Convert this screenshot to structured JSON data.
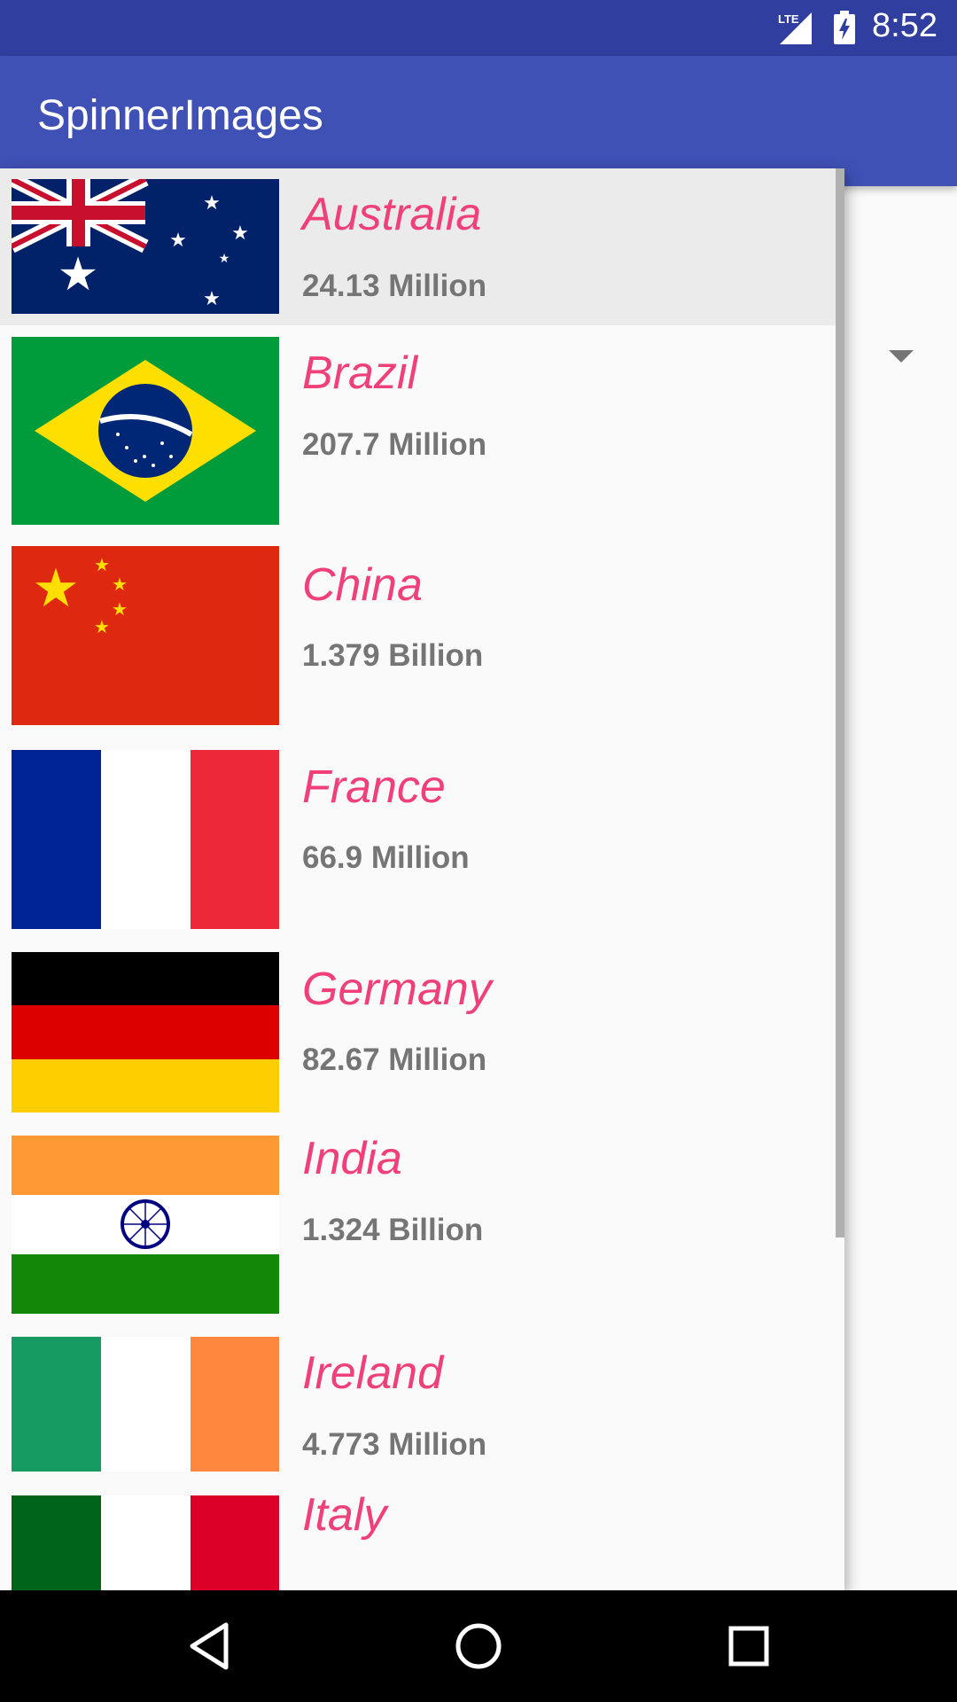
{
  "status_bar": {
    "time": "8:52",
    "network_label": "LTE",
    "icons": [
      "lte-signal-icon",
      "battery-charging-icon"
    ]
  },
  "app_bar": {
    "title": "SpinnerImages"
  },
  "spinner": {
    "arrow_icon": "dropdown-arrow-icon"
  },
  "countries": [
    {
      "name": "Australia",
      "population": "24.13 Million",
      "flag_icon": "australia-flag-icon",
      "selected": true
    },
    {
      "name": "Brazil",
      "population": "207.7 Million",
      "flag_icon": "brazil-flag-icon"
    },
    {
      "name": "China",
      "population": "1.379 Billion",
      "flag_icon": "china-flag-icon"
    },
    {
      "name": "France",
      "population": "66.9 Million",
      "flag_icon": "france-flag-icon"
    },
    {
      "name": "Germany",
      "population": "82.67 Million",
      "flag_icon": "germany-flag-icon"
    },
    {
      "name": "India",
      "population": "1.324 Billion",
      "flag_icon": "india-flag-icon"
    },
    {
      "name": "Ireland",
      "population": "4.773 Million",
      "flag_icon": "ireland-flag-icon"
    },
    {
      "name": "Italy",
      "population": "",
      "flag_icon": "italy-flag-icon"
    }
  ],
  "nav_bar": {
    "icons": [
      "back-icon",
      "home-icon",
      "recents-icon"
    ]
  },
  "colors": {
    "status_bar": "#303f9f",
    "app_bar": "#3f51b5",
    "country_name": "#f0407a",
    "population": "#757575",
    "selected_row": "#ebebeb"
  }
}
